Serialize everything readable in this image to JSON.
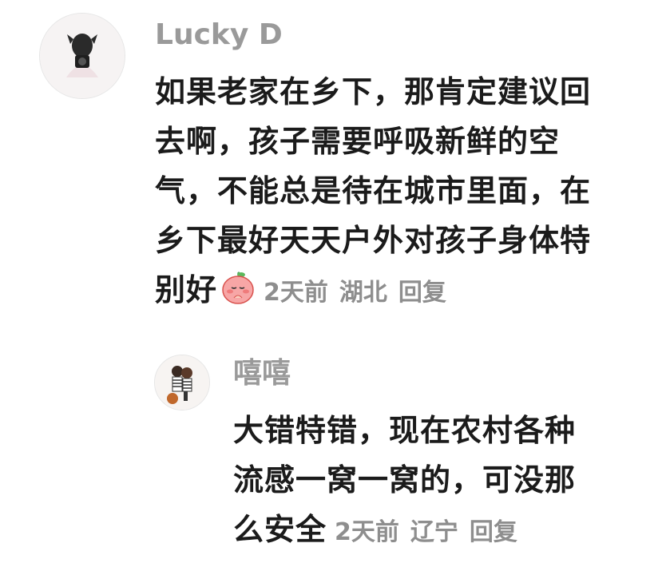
{
  "comments": [
    {
      "username": "Lucky D",
      "lines": [
        "如果老家在乡下，那肯定建议回",
        "去啊，孩子需要呼吸新鲜的空",
        "气，不能总是待在城市里面，在",
        "乡下最好天天户外对孩子身体特",
        "别好"
      ],
      "emoji_icon": "pleading-peach-emoji",
      "time": "2天前",
      "location": "湖北",
      "reply_label": "回复"
    },
    {
      "username": "嘻嘻",
      "lines": [
        "大错特错，现在农村各种",
        "流感一窝一窝的，可没那",
        "么安全"
      ],
      "time": "2天前",
      "location": "辽宁",
      "reply_label": "回复"
    }
  ]
}
